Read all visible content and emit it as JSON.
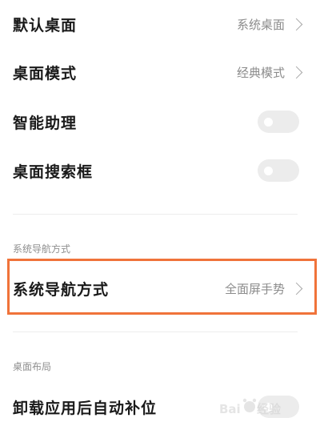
{
  "settings": {
    "default_desktop": {
      "title": "默认桌面",
      "value": "系统桌面"
    },
    "desktop_mode": {
      "title": "桌面模式",
      "value": "经典模式"
    },
    "smart_assistant": {
      "title": "智能助理"
    },
    "desktop_search": {
      "title": "桌面搜索框"
    },
    "nav_section": {
      "header": "系统导航方式"
    },
    "nav_method": {
      "title": "系统导航方式",
      "value": "全面屏手势"
    },
    "layout_section": {
      "header": "桌面布局"
    },
    "auto_fill": {
      "title": "卸载应用后自动补位"
    }
  },
  "watermark": {
    "text": "Baidu 经验"
  },
  "colors": {
    "highlight_border": "#f0733a",
    "title_text": "#1a1a1a",
    "value_text": "#8c8c8c",
    "toggle_off": "#ececec"
  },
  "icons": [
    "chevron-right-icon",
    "toggle-switch"
  ]
}
